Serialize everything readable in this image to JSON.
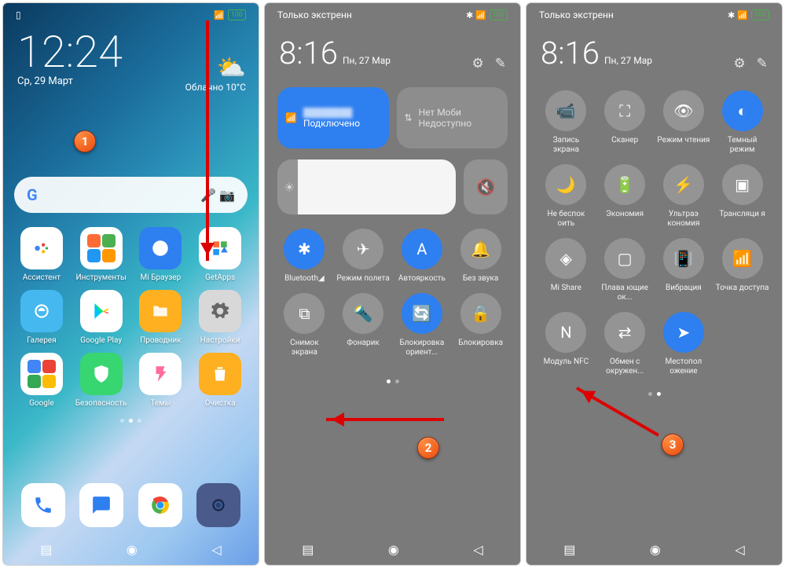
{
  "p1": {
    "status": {
      "left": "",
      "battery": "100"
    },
    "time": "12:24",
    "date": "Ср, 29 Март",
    "weather": {
      "cond": "Облачно",
      "temp": "10°C"
    },
    "apps": [
      {
        "l": "Ассистент",
        "bg": "#fff",
        "ico": "assist"
      },
      {
        "l": "Инструменты",
        "bg": "#fff",
        "ico": "tools"
      },
      {
        "l": "Mi Браузер",
        "bg": "#2e7ff0",
        "ico": "globe"
      },
      {
        "l": "GetApps",
        "bg": "#fff",
        "ico": "getapps"
      },
      {
        "l": "Галерея",
        "bg": "#45b8f0",
        "ico": "gallery"
      },
      {
        "l": "Google Play",
        "bg": "#fff",
        "ico": "play"
      },
      {
        "l": "Проводник",
        "bg": "#ffb020",
        "ico": "folder"
      },
      {
        "l": "Настройки",
        "bg": "#d8d8d8",
        "ico": "gear"
      },
      {
        "l": "Google",
        "bg": "#fff",
        "ico": "gfolder"
      },
      {
        "l": "Безопасность",
        "bg": "#38d670",
        "ico": "shield"
      },
      {
        "l": "Темы",
        "bg": "#fff",
        "ico": "theme"
      },
      {
        "l": "Очистка",
        "bg": "#ffb020",
        "ico": "trash"
      }
    ]
  },
  "p2": {
    "carrier": "Только экстренн",
    "battery": "100",
    "time": "8:16",
    "date": "Пн, 27 Мар",
    "wifi": {
      "ssid": "",
      "st": "Подключено"
    },
    "data": {
      "a": "Нет",
      "b": "Моби",
      "c": "Недоступно"
    },
    "tiles": [
      {
        "l": "Bluetooth◢",
        "i": "bt",
        "ac": 1
      },
      {
        "l": "Режим полета",
        "i": "plane",
        "ac": 0
      },
      {
        "l": "Автояркость",
        "i": "A",
        "ac": 1
      },
      {
        "l": "Без звука",
        "i": "bell",
        "ac": 0
      },
      {
        "l": "Снимок экрана",
        "i": "scut",
        "ac": 0
      },
      {
        "l": "Фонарик",
        "i": "torch",
        "ac": 0
      },
      {
        "l": "Блокировка ориент...",
        "i": "rlock",
        "ac": 1
      },
      {
        "l": "Блокировка",
        "i": "lock",
        "ac": 0
      }
    ]
  },
  "p3": {
    "carrier": "Только экстренн",
    "battery": "100",
    "time": "8:16",
    "date": "Пн, 27 Мар",
    "tiles": [
      {
        "l": "Запись экрана",
        "i": "rec",
        "ac": 0
      },
      {
        "l": "Сканер",
        "i": "scan",
        "ac": 0
      },
      {
        "l": "Режим чтения",
        "i": "eye",
        "ac": 0
      },
      {
        "l": "Темный режим",
        "i": "dark",
        "ac": 1
      },
      {
        "l": "Не беспок оить",
        "i": "moon",
        "ac": 0
      },
      {
        "l": "Экономия",
        "i": "batt",
        "ac": 0
      },
      {
        "l": "Ультраэ кономия",
        "i": "bolt",
        "ac": 0
      },
      {
        "l": "Трансляци я",
        "i": "cast",
        "ac": 0
      },
      {
        "l": "Mi Share",
        "i": "share",
        "ac": 0
      },
      {
        "l": "Плава ющие ок...",
        "i": "float",
        "ac": 0
      },
      {
        "l": "Вибрация",
        "i": "vib",
        "ac": 0
      },
      {
        "l": "Точка доступа",
        "i": "hot",
        "ac": 0
      },
      {
        "l": "Модуль NFC",
        "i": "nfc",
        "ac": 0
      },
      {
        "l": "Обмен с окружен...",
        "i": "near",
        "ac": 0
      },
      {
        "l": "Местопол ожение",
        "i": "loc",
        "ac": 1
      }
    ]
  }
}
